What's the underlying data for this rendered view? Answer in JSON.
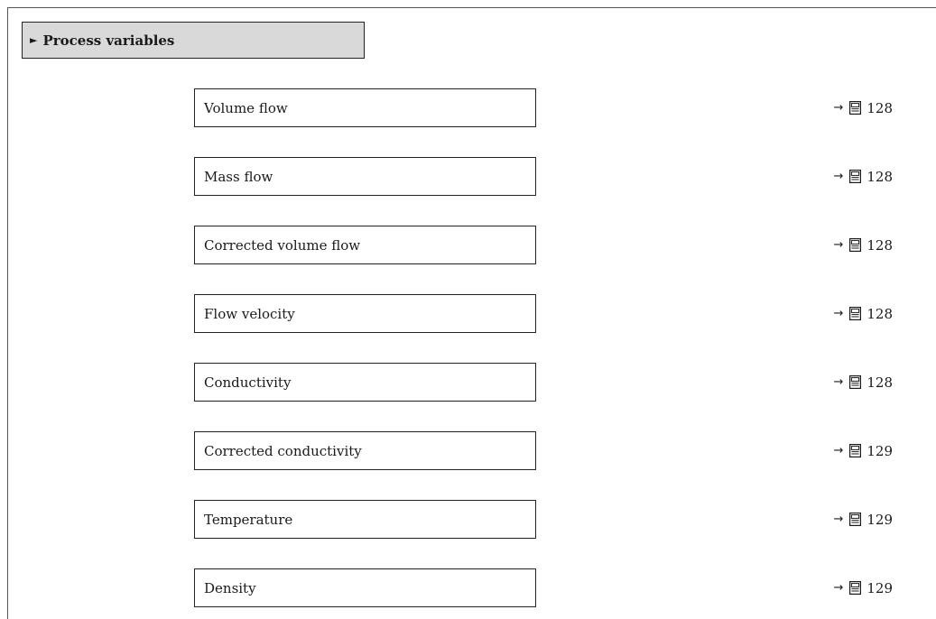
{
  "section": {
    "arrow": "►",
    "title": "Process variables"
  },
  "parameters": [
    {
      "label": "Volume flow",
      "arrow": "→",
      "icon": "book-icon",
      "page": "128"
    },
    {
      "label": "Mass flow",
      "arrow": "→",
      "icon": "book-icon",
      "page": "128"
    },
    {
      "label": "Corrected volume flow",
      "arrow": "→",
      "icon": "book-icon",
      "page": "128"
    },
    {
      "label": "Flow velocity",
      "arrow": "→",
      "icon": "book-icon",
      "page": "128"
    },
    {
      "label": "Conductivity",
      "arrow": "→",
      "icon": "book-icon",
      "page": "128"
    },
    {
      "label": "Corrected conductivity",
      "arrow": "→",
      "icon": "book-icon",
      "page": "129"
    },
    {
      "label": "Temperature",
      "arrow": "→",
      "icon": "book-icon",
      "page": "129"
    },
    {
      "label": "Density",
      "arrow": "→",
      "icon": "book-icon",
      "page": "129"
    }
  ]
}
